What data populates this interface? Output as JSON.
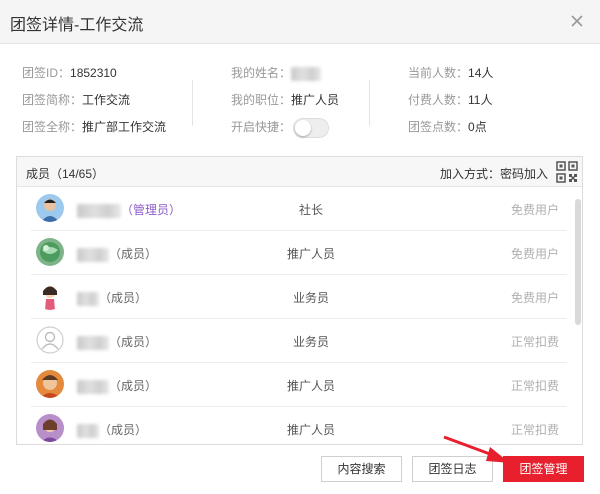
{
  "window": {
    "title": "团签详情-工作交流"
  },
  "info": {
    "col1": [
      {
        "label": "团签ID：",
        "value": "1852310"
      },
      {
        "label": "团签简称：",
        "value": "工作交流"
      },
      {
        "label": "团签全称：",
        "value": "推广部工作交流"
      }
    ],
    "col2": [
      {
        "label": "我的姓名：",
        "value": ""
      },
      {
        "label": "我的职位：",
        "value": "推广人员"
      },
      {
        "label": "开启快捷：",
        "value": "",
        "toggle": "off"
      }
    ],
    "col3": [
      {
        "label": "当前人数：",
        "value": "14人"
      },
      {
        "label": "付费人数：",
        "value": "11人"
      },
      {
        "label": "团签点数：",
        "value": "0点"
      }
    ]
  },
  "members": {
    "count_label": "成员（14/65）",
    "join_label": "加入方式：密码加入",
    "items": [
      {
        "role": "（管理员）",
        "position": "社长",
        "type": "免费用户",
        "avatar": "photo-man"
      },
      {
        "role": "（成员）",
        "position": "推广人员",
        "type": "免费用户",
        "avatar": "globe"
      },
      {
        "role": "（成员）",
        "position": "业务员",
        "type": "免费用户",
        "avatar": "cartoon-girl"
      },
      {
        "role": "（成员）",
        "position": "业务员",
        "type": "正常扣费",
        "avatar": "default-user"
      },
      {
        "role": "（成员）",
        "position": "推广人员",
        "type": "正常扣费",
        "avatar": "photo-orange"
      },
      {
        "role": "（成员）",
        "position": "推广人员",
        "type": "正常扣费",
        "avatar": "photo-purple"
      }
    ]
  },
  "buttons": {
    "search": "内容搜索",
    "log": "团签日志",
    "manage": "团签管理"
  },
  "colors": {
    "primary": "#e8202e",
    "admin": "#8e5dc7",
    "arrow": "#e8202e"
  }
}
